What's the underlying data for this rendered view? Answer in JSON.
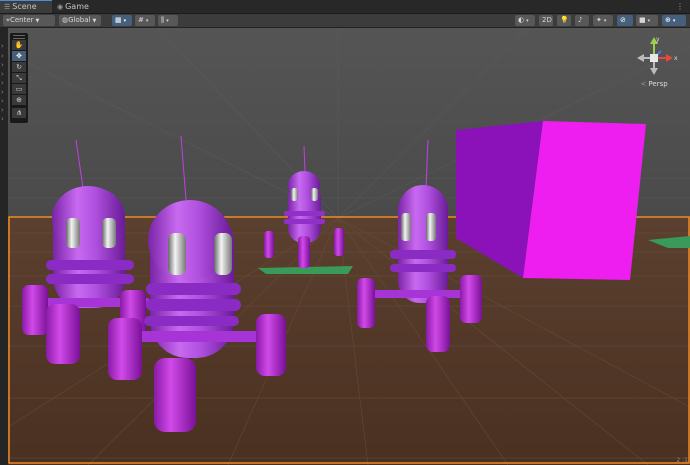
{
  "tabs": [
    {
      "label": "Scene",
      "icon": "scene-icon",
      "active": true
    },
    {
      "label": "Game",
      "icon": "gamepad-icon",
      "active": false
    }
  ],
  "tab_menu": "⋮",
  "toolbar": {
    "pivot_label": "Center",
    "space_label": "Global",
    "mode_2d_label": "2D"
  },
  "left_strip_arrows": [
    "›",
    "›",
    "›",
    "›",
    "›",
    "›",
    "›",
    "›",
    "›",
    "›",
    "›"
  ],
  "tools": [
    {
      "name": "hand-tool",
      "glyph": "✋"
    },
    {
      "name": "move-tool",
      "glyph": "✥"
    },
    {
      "name": "rotate-tool",
      "glyph": "↻"
    },
    {
      "name": "scale-tool",
      "glyph": "⤡"
    },
    {
      "name": "rect-tool",
      "glyph": "▭"
    },
    {
      "name": "transform-tool",
      "glyph": "⊕"
    },
    {
      "name": "custom-tool",
      "glyph": "⋔"
    }
  ],
  "gizmo": {
    "x_label": "x",
    "y_label": "y",
    "view_label": "Persp",
    "view_prefix": "<"
  },
  "corner_label": "2 :1",
  "colors": {
    "accent_blue": "#46607c",
    "selection_orange": "#f08a24",
    "robot_purple": "#b04ad8",
    "cube_magenta": "#ee1ef0",
    "platform_green": "#3a9a5a"
  }
}
